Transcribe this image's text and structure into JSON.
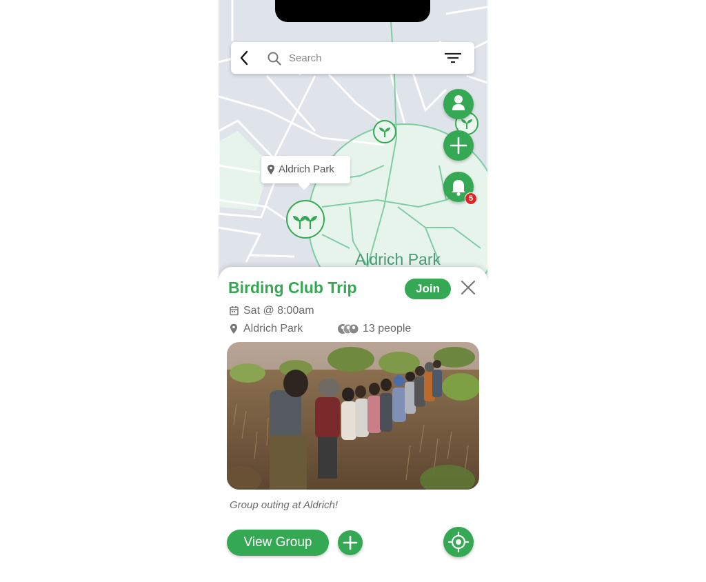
{
  "search": {
    "placeholder": "Search"
  },
  "map": {
    "tooltip_label": "Aldrich Park",
    "area_label": "Aldrich Park",
    "notification_count": "5"
  },
  "event": {
    "title": "Birding Club Trip",
    "join_label": "Join",
    "datetime": "Sat @ 8:00am",
    "location": "Aldrich Park",
    "attendees": "13 people",
    "caption": "Group outing at Aldrich!"
  },
  "actions": {
    "view_group_label": "View Group"
  },
  "colors": {
    "accent": "#34a853",
    "map_background": "#dfe4ea",
    "park_fill": "#e6f4ec",
    "badge": "#e02424"
  },
  "icons": {
    "back": "chevron-left-icon",
    "search": "search-icon",
    "filter": "filter-icon",
    "profile": "person-icon",
    "add": "plus-icon",
    "notifications": "bell-icon",
    "sprout": "sprout-icon",
    "close": "close-icon",
    "calendar": "calendar-icon",
    "pin": "location-pin-icon",
    "group": "group-icon",
    "locate": "crosshair-icon"
  }
}
